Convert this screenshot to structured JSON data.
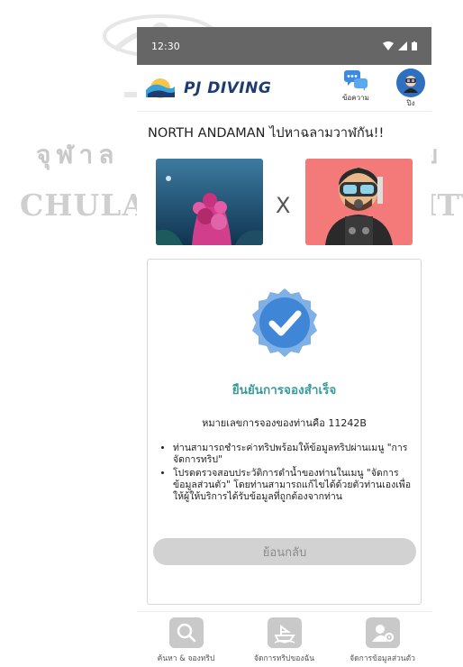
{
  "watermark": {
    "thai_left": "จุฬาล",
    "thai_right": "ย",
    "english_left": "CHULALO",
    "english_right": "ITY"
  },
  "status_bar": {
    "time": "12:30"
  },
  "app_bar": {
    "logo_text": "PJ DIVING",
    "messages_label": "ข้อความ",
    "profile_label": "ปิง"
  },
  "trip": {
    "title": "NORTH ANDAMAN ไปหาฉลามวาฬกัน!!",
    "separator": "X"
  },
  "confirmation": {
    "title": "ยืนยันการจองสำเร็จ",
    "booking_text": "หมายเลขการจองของท่านคือ 11242B",
    "notes": [
      "ท่านสามารถชำระค่าทริปพร้อมให้ข้อมูลทริปผ่านเมนู \"การจัดการทริป\"",
      "โปรดตรวจสอบประวัติการดำน้ำของท่านในเมนู \"จัดการข้อมูลส่วนตัว\" โดยท่านสามารถแก้ไขได้ด้วยตัวท่านเองเพื่อให้ผู้ให้บริการได้รับข้อมูลที่ถูกต้องจากท่าน"
    ],
    "back_label": "ย้อนกลับ"
  },
  "bottom_nav": {
    "items": [
      {
        "label": "ค้นหา & จองทริป",
        "icon": "search-icon"
      },
      {
        "label": "จัดการทริปของฉัน",
        "icon": "boat-icon"
      },
      {
        "label": "จัดการข้อมูลส่วนตัว",
        "icon": "user-settings-icon"
      }
    ]
  },
  "colors": {
    "status_bar": "#666666",
    "accent_teal": "#3a9a9a",
    "badge_blue": "#4a8ad4",
    "logo_navy": "#1f3c70",
    "button_grey": "#d2d2d2"
  }
}
